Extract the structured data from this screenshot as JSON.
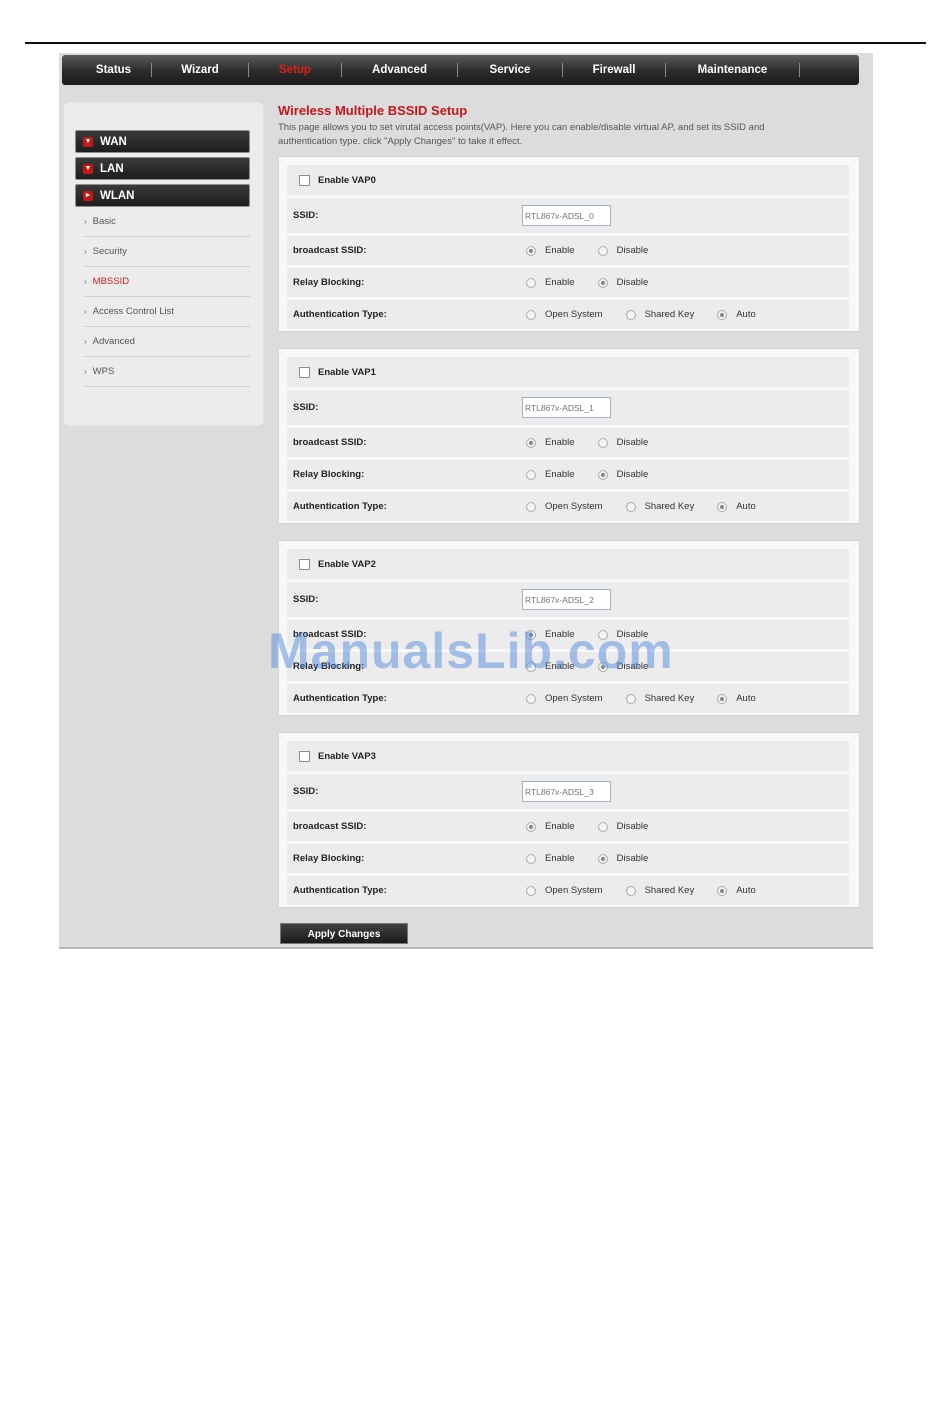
{
  "topnav": [
    "Status",
    "Wizard",
    "Setup",
    "Advanced",
    "Service",
    "Firewall",
    "Maintenance"
  ],
  "active_nav": "Setup",
  "sidebar": {
    "categories": [
      "WAN",
      "LAN",
      "WLAN"
    ],
    "wlan_items": [
      "Basic",
      "Security",
      "MBSSID",
      "Access Control List",
      "Advanced",
      "WPS"
    ],
    "active_item": "MBSSID"
  },
  "page": {
    "title": "Wireless Multiple BSSID Setup",
    "description": "This page allows you to set virutal access points(VAP). Here you can enable/disable virtual AP, and set its SSID and authentication type. click \"Apply Changes\" to take it effect."
  },
  "labels": {
    "ssid": "SSID:",
    "broadcast": "broadcast SSID:",
    "relay": "Relay Blocking:",
    "auth": "Authentication Type:",
    "enable": "Enable",
    "disable": "Disable",
    "open_system": "Open System",
    "shared_key": "Shared Key",
    "auto": "Auto"
  },
  "vaps": [
    {
      "label": "Enable VAP0",
      "enabled": false,
      "ssid_placeholder": "RTL867x-ADSL_0",
      "broadcast": "Enable",
      "relay": "Disable",
      "auth": "Auto"
    },
    {
      "label": "Enable VAP1",
      "enabled": false,
      "ssid_placeholder": "RTL867x-ADSL_1",
      "broadcast": "Enable",
      "relay": "Disable",
      "auth": "Auto"
    },
    {
      "label": "Enable VAP2",
      "enabled": false,
      "ssid_placeholder": "RTL867x-ADSL_2",
      "broadcast": "Enable",
      "relay": "Disable",
      "auth": "Auto"
    },
    {
      "label": "Enable VAP3",
      "enabled": false,
      "ssid_placeholder": "RTL867x-ADSL_3",
      "broadcast": "Enable",
      "relay": "Disable",
      "auth": "Auto"
    }
  ],
  "apply_label": "Apply Changes",
  "watermark": "ManualsLib.com",
  "colors": {
    "accent_red": "#c8151b",
    "nav_dark": "#2b2b2b",
    "panel_bg": "#dcdcdc"
  }
}
